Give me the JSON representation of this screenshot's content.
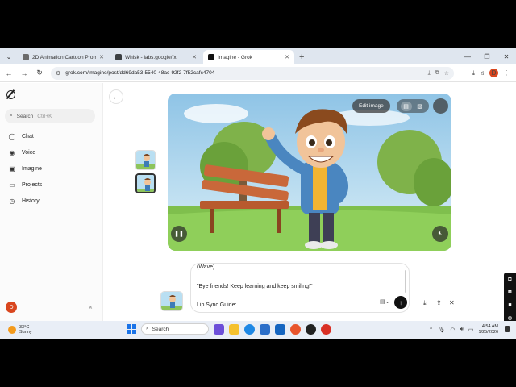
{
  "browser": {
    "tabs": [
      {
        "title": "2D Animation Cartoon Prompt",
        "favicon_color": "#6b6b6b",
        "active": false
      },
      {
        "title": "Whisk - labs.google/fx",
        "favicon_color": "#3c4043",
        "active": false
      },
      {
        "title": "Imagine - Grok",
        "favicon_color": "#111111",
        "active": true
      }
    ],
    "url": "grok.com/imagine/post/dd69da53-5540-48ac-92f2-7f52cafc4704",
    "profile_initial": "D"
  },
  "sidebar": {
    "search_label": "Search",
    "search_shortcut": "Ctrl+K",
    "items": [
      {
        "label": "Chat",
        "icon": "chat-icon",
        "glyph": "◯"
      },
      {
        "label": "Voice",
        "icon": "voice-icon",
        "glyph": "◉"
      },
      {
        "label": "Imagine",
        "icon": "imagine-icon",
        "glyph": "▣"
      },
      {
        "label": "Projects",
        "icon": "projects-icon",
        "glyph": "▭"
      },
      {
        "label": "History",
        "icon": "history-icon",
        "glyph": "◷"
      }
    ],
    "user_initial": "D"
  },
  "viewer": {
    "edit_label": "Edit image"
  },
  "prompt": {
    "lines": [
      "(Wave)",
      "\"Bye friends! Keep learning and keep smiling!\"",
      "Lip Sync Guide:"
    ]
  },
  "taskbar": {
    "temperature": "33°C",
    "condition": "Sunny",
    "search_label": "Search",
    "time": "4:54 AM",
    "date": "1/25/2026"
  },
  "colors": {
    "accent": "#d9461e",
    "sky": "#9ecbe8",
    "grass": "#7fbf4d"
  }
}
